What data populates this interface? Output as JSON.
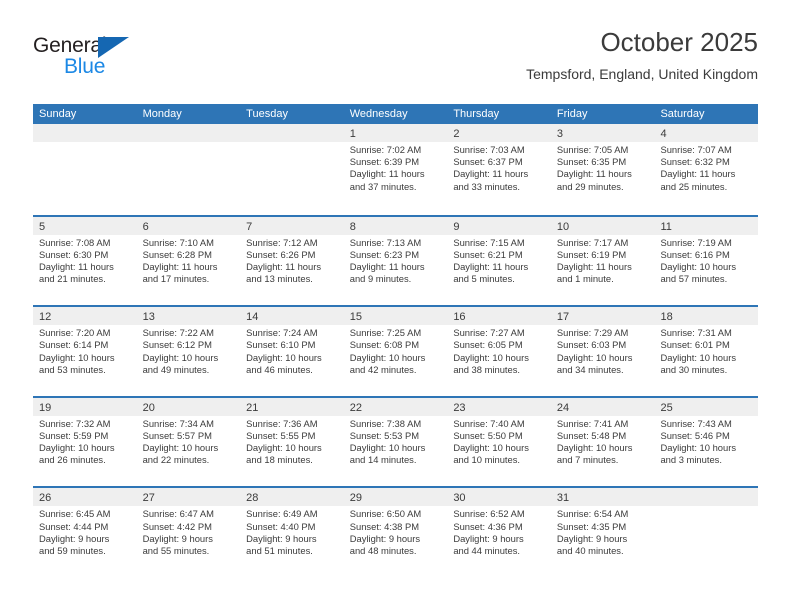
{
  "brand": {
    "name_part1": "General",
    "name_part2": "Blue",
    "accent_color": "#1567b2",
    "blue_text_color": "#1c88e5"
  },
  "header": {
    "title": "October 2025",
    "subtitle": "Tempsford, England, United Kingdom"
  },
  "theme": {
    "header_bar_color": "#2e75b6",
    "daynum_band_color": "#efefef",
    "text_color": "#3b3b3b"
  },
  "weekdays": [
    "Sunday",
    "Monday",
    "Tuesday",
    "Wednesday",
    "Thursday",
    "Friday",
    "Saturday"
  ],
  "weeks": [
    [
      {
        "day": "",
        "sunrise": "",
        "sunset": "",
        "daylight_line1": "",
        "daylight_line2": ""
      },
      {
        "day": "",
        "sunrise": "",
        "sunset": "",
        "daylight_line1": "",
        "daylight_line2": ""
      },
      {
        "day": "",
        "sunrise": "",
        "sunset": "",
        "daylight_line1": "",
        "daylight_line2": ""
      },
      {
        "day": "1",
        "sunrise": "Sunrise: 7:02 AM",
        "sunset": "Sunset: 6:39 PM",
        "daylight_line1": "Daylight: 11 hours",
        "daylight_line2": "and 37 minutes."
      },
      {
        "day": "2",
        "sunrise": "Sunrise: 7:03 AM",
        "sunset": "Sunset: 6:37 PM",
        "daylight_line1": "Daylight: 11 hours",
        "daylight_line2": "and 33 minutes."
      },
      {
        "day": "3",
        "sunrise": "Sunrise: 7:05 AM",
        "sunset": "Sunset: 6:35 PM",
        "daylight_line1": "Daylight: 11 hours",
        "daylight_line2": "and 29 minutes."
      },
      {
        "day": "4",
        "sunrise": "Sunrise: 7:07 AM",
        "sunset": "Sunset: 6:32 PM",
        "daylight_line1": "Daylight: 11 hours",
        "daylight_line2": "and 25 minutes."
      }
    ],
    [
      {
        "day": "5",
        "sunrise": "Sunrise: 7:08 AM",
        "sunset": "Sunset: 6:30 PM",
        "daylight_line1": "Daylight: 11 hours",
        "daylight_line2": "and 21 minutes."
      },
      {
        "day": "6",
        "sunrise": "Sunrise: 7:10 AM",
        "sunset": "Sunset: 6:28 PM",
        "daylight_line1": "Daylight: 11 hours",
        "daylight_line2": "and 17 minutes."
      },
      {
        "day": "7",
        "sunrise": "Sunrise: 7:12 AM",
        "sunset": "Sunset: 6:26 PM",
        "daylight_line1": "Daylight: 11 hours",
        "daylight_line2": "and 13 minutes."
      },
      {
        "day": "8",
        "sunrise": "Sunrise: 7:13 AM",
        "sunset": "Sunset: 6:23 PM",
        "daylight_line1": "Daylight: 11 hours",
        "daylight_line2": "and 9 minutes."
      },
      {
        "day": "9",
        "sunrise": "Sunrise: 7:15 AM",
        "sunset": "Sunset: 6:21 PM",
        "daylight_line1": "Daylight: 11 hours",
        "daylight_line2": "and 5 minutes."
      },
      {
        "day": "10",
        "sunrise": "Sunrise: 7:17 AM",
        "sunset": "Sunset: 6:19 PM",
        "daylight_line1": "Daylight: 11 hours",
        "daylight_line2": "and 1 minute."
      },
      {
        "day": "11",
        "sunrise": "Sunrise: 7:19 AM",
        "sunset": "Sunset: 6:16 PM",
        "daylight_line1": "Daylight: 10 hours",
        "daylight_line2": "and 57 minutes."
      }
    ],
    [
      {
        "day": "12",
        "sunrise": "Sunrise: 7:20 AM",
        "sunset": "Sunset: 6:14 PM",
        "daylight_line1": "Daylight: 10 hours",
        "daylight_line2": "and 53 minutes."
      },
      {
        "day": "13",
        "sunrise": "Sunrise: 7:22 AM",
        "sunset": "Sunset: 6:12 PM",
        "daylight_line1": "Daylight: 10 hours",
        "daylight_line2": "and 49 minutes."
      },
      {
        "day": "14",
        "sunrise": "Sunrise: 7:24 AM",
        "sunset": "Sunset: 6:10 PM",
        "daylight_line1": "Daylight: 10 hours",
        "daylight_line2": "and 46 minutes."
      },
      {
        "day": "15",
        "sunrise": "Sunrise: 7:25 AM",
        "sunset": "Sunset: 6:08 PM",
        "daylight_line1": "Daylight: 10 hours",
        "daylight_line2": "and 42 minutes."
      },
      {
        "day": "16",
        "sunrise": "Sunrise: 7:27 AM",
        "sunset": "Sunset: 6:05 PM",
        "daylight_line1": "Daylight: 10 hours",
        "daylight_line2": "and 38 minutes."
      },
      {
        "day": "17",
        "sunrise": "Sunrise: 7:29 AM",
        "sunset": "Sunset: 6:03 PM",
        "daylight_line1": "Daylight: 10 hours",
        "daylight_line2": "and 34 minutes."
      },
      {
        "day": "18",
        "sunrise": "Sunrise: 7:31 AM",
        "sunset": "Sunset: 6:01 PM",
        "daylight_line1": "Daylight: 10 hours",
        "daylight_line2": "and 30 minutes."
      }
    ],
    [
      {
        "day": "19",
        "sunrise": "Sunrise: 7:32 AM",
        "sunset": "Sunset: 5:59 PM",
        "daylight_line1": "Daylight: 10 hours",
        "daylight_line2": "and 26 minutes."
      },
      {
        "day": "20",
        "sunrise": "Sunrise: 7:34 AM",
        "sunset": "Sunset: 5:57 PM",
        "daylight_line1": "Daylight: 10 hours",
        "daylight_line2": "and 22 minutes."
      },
      {
        "day": "21",
        "sunrise": "Sunrise: 7:36 AM",
        "sunset": "Sunset: 5:55 PM",
        "daylight_line1": "Daylight: 10 hours",
        "daylight_line2": "and 18 minutes."
      },
      {
        "day": "22",
        "sunrise": "Sunrise: 7:38 AM",
        "sunset": "Sunset: 5:53 PM",
        "daylight_line1": "Daylight: 10 hours",
        "daylight_line2": "and 14 minutes."
      },
      {
        "day": "23",
        "sunrise": "Sunrise: 7:40 AM",
        "sunset": "Sunset: 5:50 PM",
        "daylight_line1": "Daylight: 10 hours",
        "daylight_line2": "and 10 minutes."
      },
      {
        "day": "24",
        "sunrise": "Sunrise: 7:41 AM",
        "sunset": "Sunset: 5:48 PM",
        "daylight_line1": "Daylight: 10 hours",
        "daylight_line2": "and 7 minutes."
      },
      {
        "day": "25",
        "sunrise": "Sunrise: 7:43 AM",
        "sunset": "Sunset: 5:46 PM",
        "daylight_line1": "Daylight: 10 hours",
        "daylight_line2": "and 3 minutes."
      }
    ],
    [
      {
        "day": "26",
        "sunrise": "Sunrise: 6:45 AM",
        "sunset": "Sunset: 4:44 PM",
        "daylight_line1": "Daylight: 9 hours",
        "daylight_line2": "and 59 minutes."
      },
      {
        "day": "27",
        "sunrise": "Sunrise: 6:47 AM",
        "sunset": "Sunset: 4:42 PM",
        "daylight_line1": "Daylight: 9 hours",
        "daylight_line2": "and 55 minutes."
      },
      {
        "day": "28",
        "sunrise": "Sunrise: 6:49 AM",
        "sunset": "Sunset: 4:40 PM",
        "daylight_line1": "Daylight: 9 hours",
        "daylight_line2": "and 51 minutes."
      },
      {
        "day": "29",
        "sunrise": "Sunrise: 6:50 AM",
        "sunset": "Sunset: 4:38 PM",
        "daylight_line1": "Daylight: 9 hours",
        "daylight_line2": "and 48 minutes."
      },
      {
        "day": "30",
        "sunrise": "Sunrise: 6:52 AM",
        "sunset": "Sunset: 4:36 PM",
        "daylight_line1": "Daylight: 9 hours",
        "daylight_line2": "and 44 minutes."
      },
      {
        "day": "31",
        "sunrise": "Sunrise: 6:54 AM",
        "sunset": "Sunset: 4:35 PM",
        "daylight_line1": "Daylight: 9 hours",
        "daylight_line2": "and 40 minutes."
      },
      {
        "day": "",
        "sunrise": "",
        "sunset": "",
        "daylight_line1": "",
        "daylight_line2": ""
      }
    ]
  ]
}
